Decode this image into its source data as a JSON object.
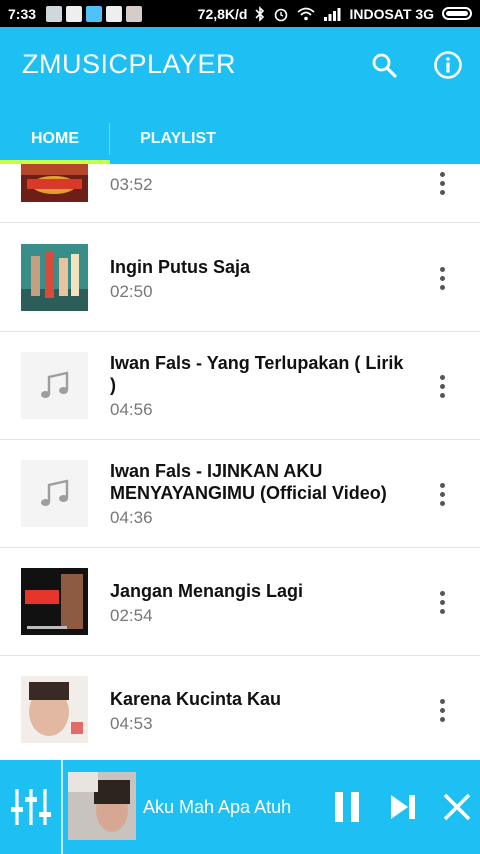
{
  "status_bar": {
    "time": "7:33",
    "notification_icons": [
      "gallery-icon",
      "gallery-icon",
      "music-icon",
      "radio-icon",
      "camera-icon"
    ],
    "network_speed": "72,8K/d",
    "carrier": "INDOSAT 3G"
  },
  "app": {
    "title": "ZMUSICPLAYER",
    "accent_color": "#1ec0f4",
    "tab_indicator_color": "#c6ff4b"
  },
  "tabs": [
    {
      "label": "HOME",
      "selected": true
    },
    {
      "label": "PLAYLIST",
      "selected": false
    }
  ],
  "tracks": [
    {
      "title": "",
      "duration": "03:52",
      "art": "album-art"
    },
    {
      "title": "Ingin Putus Saja",
      "duration": "02:50",
      "art": "album-art"
    },
    {
      "title": "Iwan Fals  - Yang Terlupakan ( Lirik )",
      "duration": "04:56",
      "art": "music-note-icon"
    },
    {
      "title": "Iwan Fals - IJINKAN AKU MENYAYANGIMU (Official Video)",
      "duration": "04:36",
      "art": "music-note-icon"
    },
    {
      "title": "Jangan Menangis Lagi",
      "duration": "02:54",
      "art": "album-art"
    },
    {
      "title": "Karena Kucinta Kau",
      "duration": "04:53",
      "art": "album-art"
    }
  ],
  "now_playing": {
    "title": "Aku Mah Apa Atuh",
    "state": "playing"
  }
}
